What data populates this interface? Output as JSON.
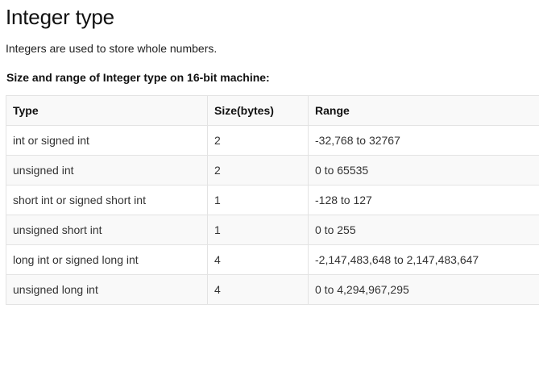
{
  "page": {
    "title": "Integer type",
    "intro": "Integers are used to store whole numbers.",
    "table_heading": "Size and range of Integer type on 16-bit machine:"
  },
  "table": {
    "headers": [
      "Type",
      "Size(bytes)",
      "Range"
    ],
    "rows": [
      [
        "int or signed int",
        "2",
        "-32,768 to 32767"
      ],
      [
        "unsigned int",
        "2",
        "0 to 65535"
      ],
      [
        "short int or signed short int",
        "1",
        "-128 to 127"
      ],
      [
        "unsigned short int",
        "1",
        "0 to 255"
      ],
      [
        "long int or signed long int",
        "4",
        "-2,147,483,648 to 2,147,483,647"
      ],
      [
        "unsigned long int",
        "4",
        "0 to 4,294,967,295"
      ]
    ]
  },
  "colors": {
    "border": "#e3e3e3",
    "stripe": "#f9f9f9",
    "text": "#222222"
  }
}
